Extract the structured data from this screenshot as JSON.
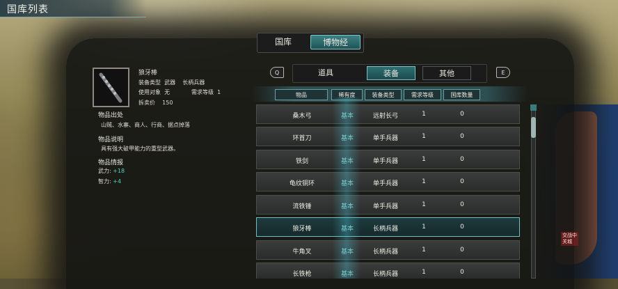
{
  "window": {
    "title": "国库列表"
  },
  "top_tabs": [
    {
      "label": "国库"
    },
    {
      "label": "博物经"
    }
  ],
  "item": {
    "name": "狼牙棒",
    "type_label": "装备类型",
    "type_value": "武器",
    "subtype_value": "长柄兵器",
    "user_label": "使用对象",
    "user_value": "无",
    "req_label": "需求等级",
    "req_value": "1",
    "price_label": "拆卖价",
    "price_value": "150",
    "source_heading": "物品出处",
    "source_text": "山贼、水寨、商人、行商、据点掉落",
    "desc_heading": "物品说明",
    "desc_text": "具有强大破甲能力的重型武器。",
    "stats_heading": "物品情报",
    "stats": [
      {
        "label": "武力:",
        "value": "+18"
      },
      {
        "label": "智力:",
        "value": "+4"
      }
    ]
  },
  "category_tabs": [
    {
      "label": "道具"
    },
    {
      "label": "装备"
    },
    {
      "label": "其他"
    }
  ],
  "keys": {
    "prev": "Q",
    "next": "E"
  },
  "table": {
    "headers": [
      "物品",
      "稀有度",
      "装备类型",
      "需求等级",
      "国库数量"
    ],
    "rows": [
      {
        "name": "桑木弓",
        "rarity": "基本",
        "type": "远射长弓",
        "req": "1",
        "count": "0"
      },
      {
        "name": "环首刀",
        "rarity": "基本",
        "type": "单手兵器",
        "req": "1",
        "count": "0"
      },
      {
        "name": "铁剑",
        "rarity": "基本",
        "type": "单手兵器",
        "req": "1",
        "count": "0"
      },
      {
        "name": "龟纹铜环",
        "rarity": "基本",
        "type": "单手兵器",
        "req": "1",
        "count": "0"
      },
      {
        "name": "流铁锤",
        "rarity": "基本",
        "type": "单手兵器",
        "req": "1",
        "count": "0"
      },
      {
        "name": "狼牙棒",
        "rarity": "基本",
        "type": "长柄兵器",
        "req": "1",
        "count": "0"
      },
      {
        "name": "牛角叉",
        "rarity": "基本",
        "type": "长柄兵器",
        "req": "1",
        "count": "0"
      },
      {
        "name": "长铁枪",
        "rarity": "基本",
        "type": "长柄兵器",
        "req": "1",
        "count": "0"
      }
    ],
    "selected_index": 5
  },
  "map_badge": {
    "line1": "交战中",
    "line2": "关城"
  }
}
